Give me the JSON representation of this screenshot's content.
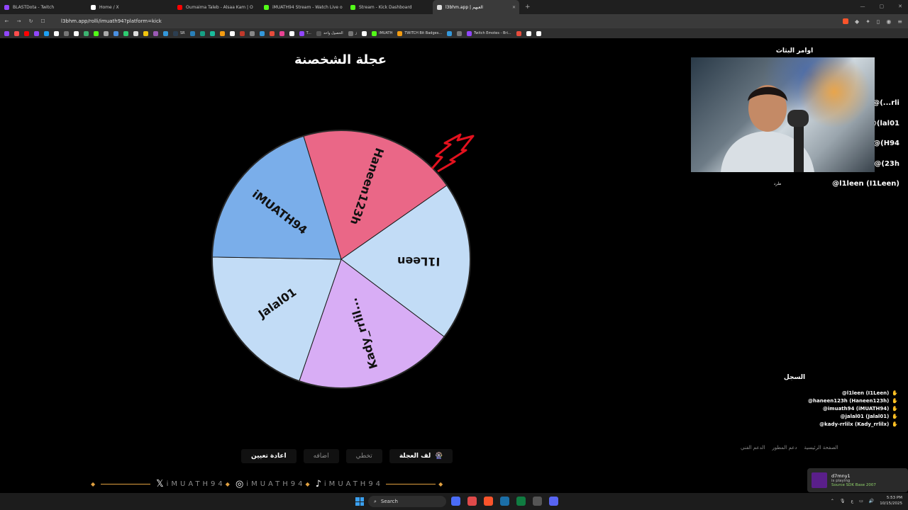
{
  "browser": {
    "tabs": [
      {
        "label": "BLASTDota - Twitch",
        "color": "#9146ff"
      },
      {
        "label": "Home / X",
        "color": "#ffffff"
      },
      {
        "label": "Oumaima Taleb - Alsaa Kam | O",
        "color": "#ff0000"
      },
      {
        "label": "iMUATH94 Stream - Watch Live o",
        "color": "#53fc18"
      },
      {
        "label": "Stream - Kick Dashboard",
        "color": "#53fc18"
      },
      {
        "label": "l3bhm.app | العبهم",
        "color": "#dddddd",
        "active": true
      }
    ],
    "new_tab": "+",
    "url": "l3bhm.app/rolli/imuath94?platform=kick",
    "bookmarks": [
      {
        "label": "",
        "color": "#9146ff"
      },
      {
        "label": "",
        "color": "#ff4d4d"
      },
      {
        "label": "",
        "color": "#ff0000"
      },
      {
        "label": "",
        "color": "#9146ff"
      },
      {
        "label": "",
        "color": "#1da1f2"
      },
      {
        "label": "",
        "color": "#ffffff"
      },
      {
        "label": "",
        "color": "#777777"
      },
      {
        "label": "",
        "color": "#ffffff"
      },
      {
        "label": "",
        "color": "#3cb371"
      },
      {
        "label": "",
        "color": "#53fc18"
      },
      {
        "label": "",
        "color": "#aaaaaa"
      },
      {
        "label": "",
        "color": "#4a90e2"
      },
      {
        "label": "",
        "color": "#2ecc71"
      },
      {
        "label": "",
        "color": "#dddddd"
      },
      {
        "label": "",
        "color": "#f1c40f"
      },
      {
        "label": "",
        "color": "#9b59b6"
      },
      {
        "label": "",
        "color": "#3498db"
      },
      {
        "label": "SR",
        "color": "#2c3e50"
      },
      {
        "label": "",
        "color": "#2980b9"
      },
      {
        "label": "",
        "color": "#16a085"
      },
      {
        "label": "",
        "color": "#1abc9c"
      },
      {
        "label": "",
        "color": "#f39c12"
      },
      {
        "label": "",
        "color": "#ffffff"
      },
      {
        "label": "",
        "color": "#c0392b"
      },
      {
        "label": "",
        "color": "#888888"
      },
      {
        "label": "",
        "color": "#3498db"
      },
      {
        "label": "",
        "color": "#e74c3c"
      },
      {
        "label": "",
        "color": "#e84393"
      },
      {
        "label": "",
        "color": "#ffffff"
      },
      {
        "label": "T...",
        "color": "#9146ff"
      },
      {
        "label": "الحصول واحد",
        "color": "#555555"
      },
      {
        "label": "ژ",
        "color": "#777777"
      },
      {
        "label": "",
        "color": "#ffffff"
      },
      {
        "label": "iMUATH",
        "color": "#53fc18"
      },
      {
        "label": "TWITCH Bit Badges...",
        "color": "#f39c12"
      },
      {
        "label": "",
        "color": "#3498db"
      },
      {
        "label": "",
        "color": "#777777"
      },
      {
        "label": "Twitch Emotes - Bri...",
        "color": "#9146ff"
      },
      {
        "label": "",
        "color": "#e74c3c"
      },
      {
        "label": "",
        "color": "#ffffff"
      },
      {
        "label": "",
        "color": "#ffffff"
      }
    ]
  },
  "wheel": {
    "title": "عجلة الشخصنة",
    "segments": [
      {
        "label": "Haneen123h",
        "color": "#ea6787"
      },
      {
        "label": "I1Leen",
        "color": "#c2dcf6"
      },
      {
        "label": "Kady_rrlil...",
        "color": "#d8adf5"
      },
      {
        "label": "Jalal01",
        "color": "#c2dcf6"
      },
      {
        "label": "iMUATH94",
        "color": "#7aaeea"
      }
    ],
    "pointer_color": "#e3111e"
  },
  "controls": {
    "reset": "اعادة تعيين",
    "add": "اضافه",
    "skip": "تخطي",
    "spin": "لف العجلة",
    "spin_icon": "🎡"
  },
  "footer_brand": {
    "handle": "iMUATH94",
    "icons": [
      "x-icon",
      "instagram-icon",
      "tiktok-icon"
    ]
  },
  "panel": {
    "commands_title": "اوامر البثاث",
    "commands": [
      "@(...rli",
      "@(lal01",
      "@(H94",
      "@(23h",
      "@l1leen (I1Leen)"
    ],
    "kick_label": "طرد",
    "log_title": "السجل",
    "log_entries": [
      "@l1leen (I1Leen)",
      "@haneen123h (Haneen123h)",
      "@imuath94 (iMUATH94)",
      "@jalal01 (Jalal01)",
      "@kady-rrlilx (Kady_rrlilx)"
    ],
    "links": [
      "الدعم الفني",
      "دعم المطور",
      "الصفحة الرئيسية"
    ]
  },
  "toast": {
    "name": "d7mny1",
    "status": "is playing",
    "game": "Source SDK Base 2007"
  },
  "taskbar": {
    "search": "Search",
    "lang": "ع",
    "time": "5:53 PM",
    "date": "10/15/2025"
  }
}
